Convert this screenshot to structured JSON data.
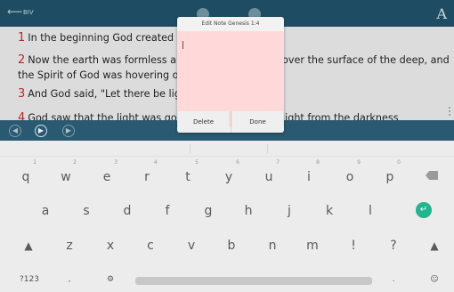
{
  "topbar": {
    "back_icon": "back-arrow-icon",
    "title": "BIV",
    "font_icon_label": "A"
  },
  "verses": [
    {
      "num": "1",
      "text": "In the beginning God created the",
      "tail": "."
    },
    {
      "num": "2",
      "text": "Now the earth was formless and",
      "tail": "over the surface of the deep, and the Spirit of God was hovering ove"
    },
    {
      "num": "3",
      "text": "And God said, \"Let there be light,",
      "tail": ""
    },
    {
      "num": "4",
      "text": "God saw that the light was good",
      "tail": "light from the darkness"
    }
  ],
  "dialog": {
    "title": "Edit Note  Genesis 1:4",
    "delete_label": "Delete",
    "done_label": "Done",
    "note_bg": "#ffd9d9"
  },
  "keyboard": {
    "row1": [
      {
        "k": "q",
        "h": "1"
      },
      {
        "k": "w",
        "h": "2"
      },
      {
        "k": "e",
        "h": "3"
      },
      {
        "k": "r",
        "h": "4"
      },
      {
        "k": "t",
        "h": "5"
      },
      {
        "k": "y",
        "h": "6"
      },
      {
        "k": "u",
        "h": "7"
      },
      {
        "k": "i",
        "h": "8"
      },
      {
        "k": "o",
        "h": "9"
      },
      {
        "k": "p",
        "h": "0"
      }
    ],
    "row2": [
      "a",
      "s",
      "d",
      "f",
      "g",
      "h",
      "j",
      "k",
      "l"
    ],
    "row3": [
      "z",
      "x",
      "c",
      "v",
      "b",
      "n",
      "m",
      "!",
      "?"
    ],
    "symbols_label": "?123",
    "comma_label": ",",
    "period_label": ".",
    "accent": "#22b38f"
  }
}
